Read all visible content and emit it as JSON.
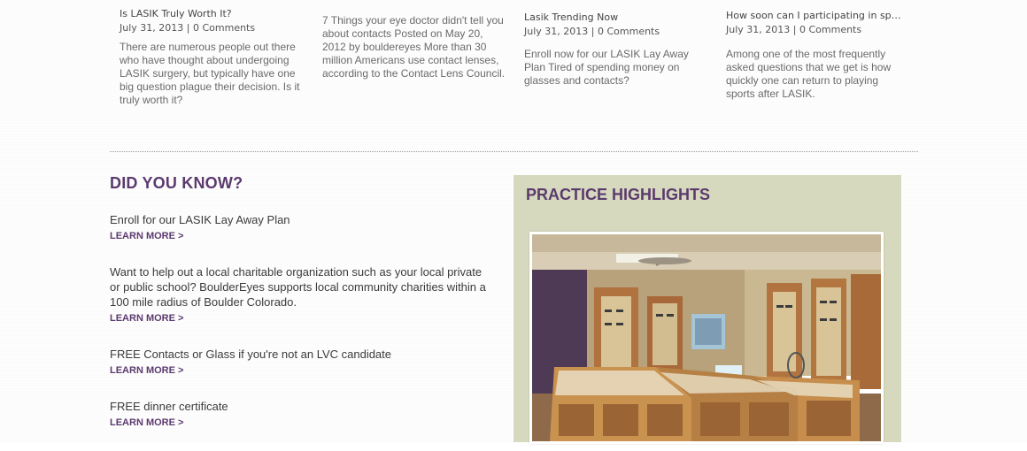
{
  "posts": [
    {
      "title": "Is LASIK Truly Worth It?",
      "date": "July 31, 2013",
      "sep": "|",
      "comments": "0 Comments",
      "excerpt": "There are numerous people out there who have thought about undergoing LASIK surgery, but typically have one big question plague their decision. Is it truly worth it?"
    },
    {
      "title": "",
      "date": "",
      "sep": "",
      "comments": "",
      "excerpt": "7 Things your eye doctor didn't tell you about contacts Posted on May 20, 2012 by bouldereyes More than 30 million Americans use contact lenses, according to the Contact Lens Council."
    },
    {
      "title": "Lasik Trending Now",
      "date": "July 31, 2013",
      "sep": "|",
      "comments": "0 Comments",
      "excerpt": "Enroll now for our LASIK Lay Away Plan Tired of spending money on glasses and contacts?"
    },
    {
      "title": "How soon can I participating in spo...",
      "date": "July 31, 2013",
      "sep": "|",
      "comments": "0 Comments",
      "excerpt": "Among one of the most frequently asked questions that we get is how quickly one can return to playing sports after LASIK."
    }
  ],
  "did_you_know": {
    "heading": "DID YOU KNOW?",
    "items": [
      {
        "text": "Enroll for our LASIK Lay Away Plan",
        "link": "LEARN MORE >"
      },
      {
        "text": "Want to help out a local charitable organization such as your local private or public school? BoulderEyes supports local community charities within a 100 mile radius of Boulder Colorado.",
        "link": "LEARN MORE >"
      },
      {
        "text": "FREE Contacts or Glass if you're not an LVC candidate",
        "link": "LEARN MORE >"
      },
      {
        "text": "FREE dinner certificate",
        "link": "LEARN MORE >"
      }
    ]
  },
  "practice_highlights": {
    "heading": "PRACTICE HIGHLIGHTS"
  },
  "colors": {
    "accent_purple": "#5b3a6e",
    "panel_green": "#d6d9bd"
  }
}
